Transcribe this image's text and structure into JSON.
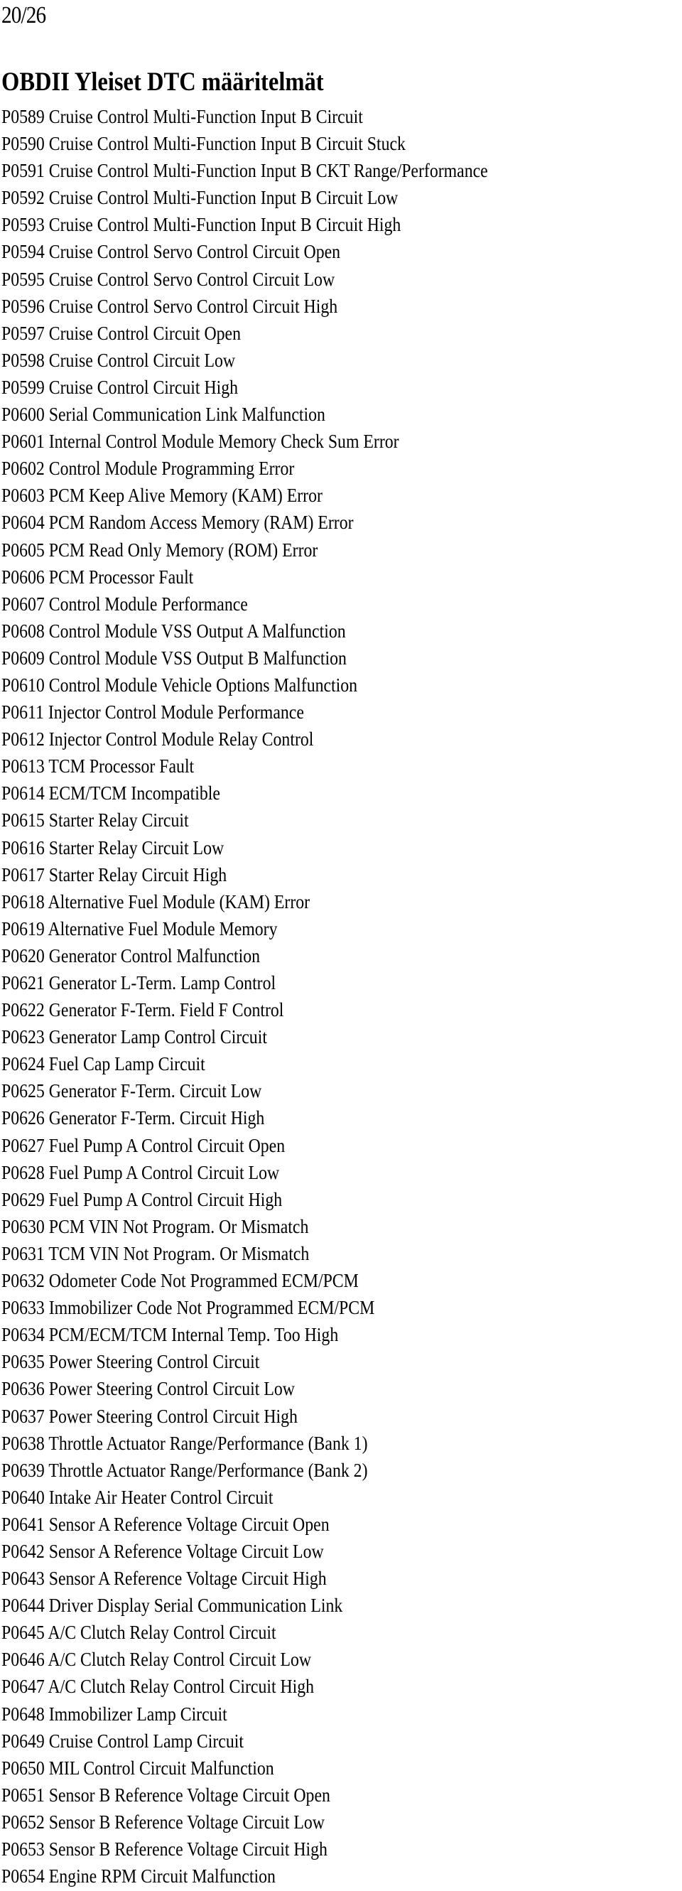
{
  "page": {
    "page_number": "20/26",
    "title": "OBDII Yleiset DTC määritelmät"
  },
  "dtc_codes": [
    {
      "code": "P0589",
      "description": "Cruise Control Multi-Function Input B Circuit"
    },
    {
      "code": "P0590",
      "description": "Cruise Control Multi-Function Input B Circuit Stuck"
    },
    {
      "code": "P0591",
      "description": "Cruise Control Multi-Function Input B CKT Range/Performance"
    },
    {
      "code": "P0592",
      "description": "Cruise Control Multi-Function Input B Circuit Low"
    },
    {
      "code": "P0593",
      "description": "Cruise Control Multi-Function Input B Circuit High"
    },
    {
      "code": "P0594",
      "description": "Cruise Control Servo Control Circuit Open"
    },
    {
      "code": "P0595",
      "description": "Cruise Control Servo Control Circuit Low"
    },
    {
      "code": "P0596",
      "description": "Cruise Control Servo Control Circuit High"
    },
    {
      "code": "P0597",
      "description": "Cruise Control Circuit Open"
    },
    {
      "code": "P0598",
      "description": "Cruise Control Circuit Low"
    },
    {
      "code": "P0599",
      "description": "Cruise Control Circuit High"
    },
    {
      "code": "P0600",
      "description": "Serial Communication Link Malfunction"
    },
    {
      "code": "P0601",
      "description": "Internal Control Module Memory Check Sum Error"
    },
    {
      "code": "P0602",
      "description": "Control Module Programming Error"
    },
    {
      "code": "P0603",
      "description": "PCM Keep Alive Memory (KAM) Error"
    },
    {
      "code": "P0604",
      "description": "PCM Random Access Memory (RAM) Error"
    },
    {
      "code": "P0605",
      "description": "PCM Read Only Memory (ROM) Error"
    },
    {
      "code": "P0606",
      "description": "PCM Processor Fault"
    },
    {
      "code": "P0607",
      "description": "Control Module Performance"
    },
    {
      "code": "P0608",
      "description": "Control Module VSS Output A Malfunction"
    },
    {
      "code": "P0609",
      "description": "Control Module VSS Output B Malfunction"
    },
    {
      "code": "P0610",
      "description": "Control Module Vehicle Options Malfunction"
    },
    {
      "code": "P0611",
      "description": "Injector Control Module Performance"
    },
    {
      "code": "P0612",
      "description": "Injector Control Module Relay Control"
    },
    {
      "code": "P0613",
      "description": "TCM Processor Fault"
    },
    {
      "code": "P0614",
      "description": "ECM/TCM Incompatible"
    },
    {
      "code": "P0615",
      "description": "Starter Relay Circuit"
    },
    {
      "code": "P0616",
      "description": "Starter Relay Circuit Low"
    },
    {
      "code": "P0617",
      "description": "Starter Relay Circuit High"
    },
    {
      "code": "P0618",
      "description": "Alternative Fuel Module (KAM) Error"
    },
    {
      "code": "P0619",
      "description": "Alternative Fuel Module Memory"
    },
    {
      "code": "P0620",
      "description": "Generator Control Malfunction"
    },
    {
      "code": "P0621",
      "description": "Generator L-Term. Lamp Control"
    },
    {
      "code": "P0622",
      "description": "Generator F-Term. Field F Control"
    },
    {
      "code": "P0623",
      "description": "Generator Lamp Control Circuit"
    },
    {
      "code": "P0624",
      "description": "Fuel Cap Lamp Circuit"
    },
    {
      "code": "P0625",
      "description": "Generator F-Term. Circuit Low"
    },
    {
      "code": "P0626",
      "description": "Generator F-Term. Circuit High"
    },
    {
      "code": "P0627",
      "description": "Fuel Pump A Control Circuit Open"
    },
    {
      "code": "P0628",
      "description": "Fuel Pump A Control Circuit Low"
    },
    {
      "code": "P0629",
      "description": "Fuel Pump A Control Circuit High"
    },
    {
      "code": "P0630",
      "description": "PCM VIN Not Program. Or Mismatch"
    },
    {
      "code": "P0631",
      "description": "TCM VIN Not Program. Or Mismatch"
    },
    {
      "code": "P0632",
      "description": "Odometer Code Not Programmed ECM/PCM"
    },
    {
      "code": "P0633",
      "description": "Immobilizer Code Not Programmed ECM/PCM"
    },
    {
      "code": "P0634",
      "description": "PCM/ECM/TCM Internal Temp. Too High"
    },
    {
      "code": "P0635",
      "description": "Power Steering Control Circuit"
    },
    {
      "code": "P0636",
      "description": "Power Steering Control Circuit Low"
    },
    {
      "code": "P0637",
      "description": "Power Steering Control Circuit High"
    },
    {
      "code": "P0638",
      "description": "Throttle Actuator Range/Performance (Bank 1)"
    },
    {
      "code": "P0639",
      "description": "Throttle Actuator Range/Performance (Bank 2)"
    },
    {
      "code": "P0640",
      "description": "Intake Air Heater Control Circuit"
    },
    {
      "code": "P0641",
      "description": "Sensor A Reference Voltage Circuit Open"
    },
    {
      "code": "P0642",
      "description": "Sensor A Reference Voltage Circuit Low"
    },
    {
      "code": "P0643",
      "description": "Sensor A Reference Voltage Circuit High"
    },
    {
      "code": "P0644",
      "description": "Driver Display Serial Communication Link"
    },
    {
      "code": "P0645",
      "description": "A/C Clutch Relay Control Circuit"
    },
    {
      "code": "P0646",
      "description": "A/C Clutch Relay Control Circuit Low"
    },
    {
      "code": "P0647",
      "description": "A/C Clutch Relay Control Circuit High"
    },
    {
      "code": "P0648",
      "description": "Immobilizer Lamp Circuit"
    },
    {
      "code": "P0649",
      "description": "Cruise Control Lamp Circuit"
    },
    {
      "code": "P0650",
      "description": "MIL Control Circuit Malfunction"
    },
    {
      "code": "P0651",
      "description": "Sensor B Reference Voltage Circuit Open"
    },
    {
      "code": "P0652",
      "description": "Sensor B Reference Voltage Circuit Low"
    },
    {
      "code": "P0653",
      "description": "Sensor B Reference Voltage Circuit High"
    },
    {
      "code": "P0654",
      "description": "Engine RPM Circuit Malfunction"
    }
  ]
}
